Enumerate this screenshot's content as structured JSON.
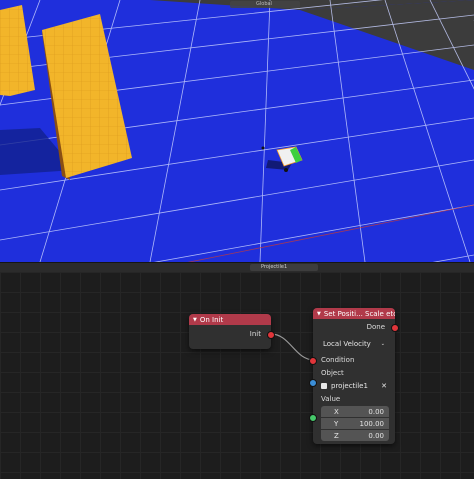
{
  "viewport": {
    "header_text": "Global",
    "colors": {
      "floor": "#1f2fdc",
      "grid": "#c8d0ff",
      "wall": "#f2b52a",
      "wall_side": "#8a4f13",
      "backdrop": "#3c3c3c"
    }
  },
  "node_editor": {
    "header": {
      "object_name": "Projectile1"
    },
    "on_init_node": {
      "title": "On Init",
      "output_label": "Init"
    },
    "set_node": {
      "title": "Set Positi... Scale etc.",
      "done_label": "Done",
      "mode_value": "Local Velocity",
      "condition_label": "Condition",
      "object_label": "Object",
      "object_value": "projectile1",
      "value_label": "Value",
      "x_label": "X",
      "x_value": "0.00",
      "y_label": "Y",
      "y_value": "100.00",
      "z_label": "Z",
      "z_value": "0.00"
    },
    "colors": {
      "node_header": "#b13a4a",
      "exec_socket": "#e0353a",
      "object_socket": "#3b8ed8",
      "vector_socket": "#46c86a"
    }
  }
}
